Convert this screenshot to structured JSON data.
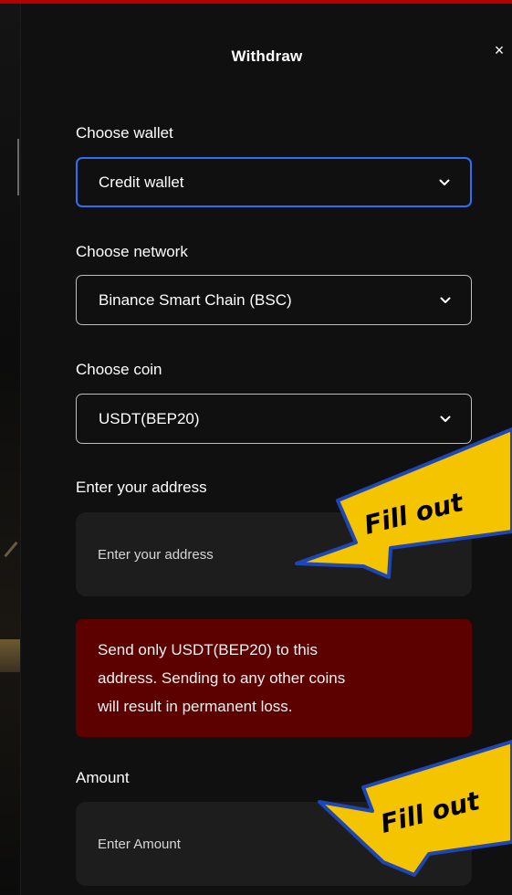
{
  "modal": {
    "title": "Withdraw",
    "close_glyph": "×"
  },
  "wallet": {
    "label": "Choose wallet",
    "selected": "Credit wallet"
  },
  "network": {
    "label": "Choose network",
    "selected": "Binance Smart Chain (BSC)"
  },
  "coin": {
    "label": "Choose coin",
    "selected": "USDT(BEP20)"
  },
  "address": {
    "label": "Enter your address",
    "placeholder": "Enter your address"
  },
  "warning": {
    "lines": [
      "Send only USDT(BEP20) to this",
      "address. Sending to any other coins",
      "will result in permanent loss."
    ]
  },
  "amount": {
    "label": "Amount",
    "placeholder": "Enter Amount"
  },
  "annotations": {
    "address_callout": "Fill out",
    "amount_callout": "Fill out"
  },
  "colors": {
    "accent_focus": "#2f6ff0",
    "warning_bg": "#5c0000",
    "callout_fill": "#f5c400",
    "callout_border": "#1e46b4"
  },
  "icons": [
    "close-icon",
    "chevron-down-icon"
  ]
}
